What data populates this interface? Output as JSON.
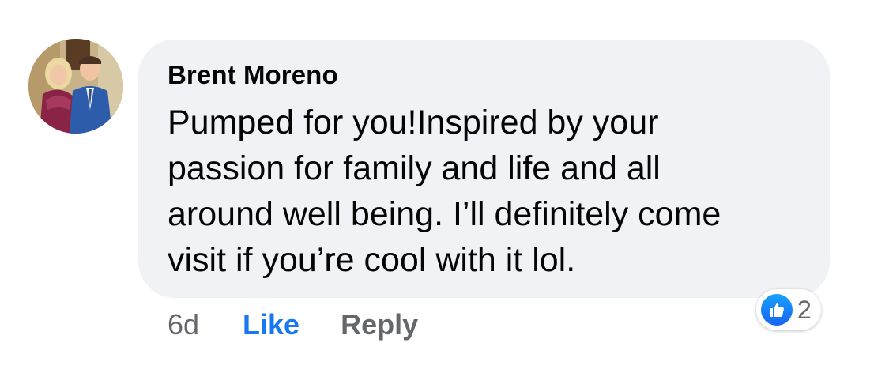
{
  "comment": {
    "author": "Brent Moreno",
    "text": "Pumped for you!Inspired by your passion for family and life and all around well being. I’ll definitely come visit if you’re cool with it lol.",
    "lines": [
      "Pumped for you!Inspired by your",
      "passion for family and life and all",
      "around well being. I’ll definitely come",
      "visit if you’re cool with it lol."
    ],
    "time": "6d",
    "like_label": "Like",
    "reply_label": "Reply",
    "reaction_count": "2",
    "reaction_icon": "thumbs-up-icon"
  },
  "colors": {
    "bubble_bg": "#f0f2f5",
    "like_blue": "#1877f2",
    "muted": "#65676b",
    "text": "#050505"
  }
}
